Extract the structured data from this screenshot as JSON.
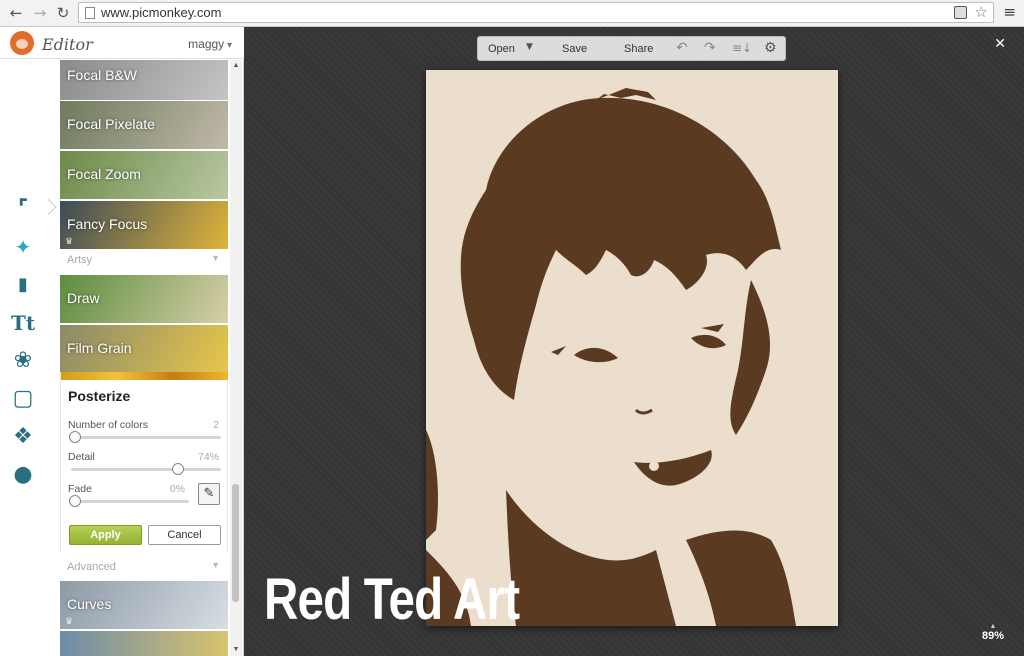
{
  "browser": {
    "url": "www.picmonkey.com",
    "back_icon": "back-arrow-icon",
    "forward_icon": "forward-arrow-icon",
    "reload_icon": "reload-icon",
    "menu_icon": "hamburger-menu-icon"
  },
  "app": {
    "title": "Editor",
    "user": "maggy"
  },
  "tools": [
    {
      "name": "crop-icon",
      "glyph": "⌗"
    },
    {
      "name": "effects-wand-icon",
      "glyph": "✨"
    },
    {
      "name": "touch-up-lipstick-icon",
      "glyph": "▎"
    },
    {
      "name": "text-icon",
      "glyph": "Tt"
    },
    {
      "name": "overlays-butterfly-icon",
      "glyph": "❀"
    },
    {
      "name": "frames-icon",
      "glyph": "▢"
    },
    {
      "name": "textures-icon",
      "glyph": "❖"
    },
    {
      "name": "themes-apple-icon",
      "glyph": "●"
    }
  ],
  "effects_top": [
    {
      "label": "Focal B&W",
      "color1": "#8a8a8a",
      "color2": "#c4c4c4"
    },
    {
      "label": "Focal Pixelate",
      "color1": "#6f7a5e",
      "color2": "#c0b9a8"
    },
    {
      "label": "Focal Zoom",
      "color1": "#6d8a48",
      "color2": "#b9c8a2"
    },
    {
      "label": "Fancy Focus",
      "color1": "#3c4b58",
      "color2": "#e1b43a"
    }
  ],
  "section_artsy": "Artsy",
  "effects_artsy": [
    {
      "label": "Draw",
      "color1": "#5b8d3f",
      "color2": "#d8cfa8"
    },
    {
      "label": "Film Grain",
      "color1": "#8a8a6a",
      "color2": "#e8c64a"
    }
  ],
  "posterize": {
    "title": "Posterize",
    "controls": [
      {
        "label": "Number of colors",
        "value": "2"
      },
      {
        "label": "Detail",
        "value": "74%"
      },
      {
        "label": "Fade",
        "value": "0%"
      }
    ],
    "apply_label": "Apply",
    "cancel_label": "Cancel"
  },
  "section_advanced": "Advanced",
  "effects_advanced": [
    {
      "label": "Curves",
      "color1": "#8d9aa6",
      "color2": "#d7dde3"
    }
  ],
  "topmenu": {
    "open_label": "Open",
    "save_label": "Save",
    "share_label": "Share"
  },
  "zoom": "89%",
  "watermark": "Red Ted Art",
  "colors": {
    "poster_light": "#ebdecd",
    "poster_dark": "#5b3a22",
    "apply_green": "#a3c03f"
  }
}
